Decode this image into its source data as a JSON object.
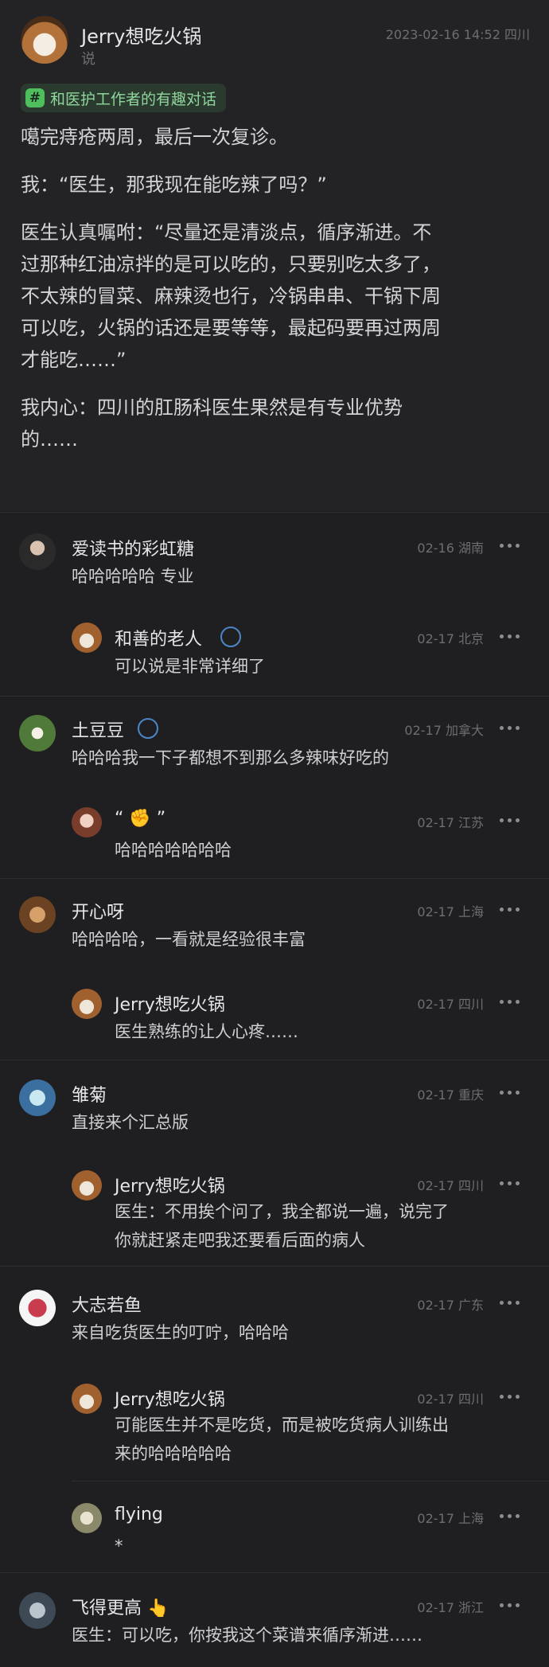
{
  "post": {
    "author": "Jerry想吃火锅",
    "action": "说",
    "time": "2023-02-16 14:52 四川",
    "tag": "和医护工作者的有趣对话",
    "lines": [
      "噶完痔疮两周，最后一次复诊。",
      "",
      "我：“医生，那我现在能吃辣了吗？”",
      "",
      "医生认真嘱咐：“尽量还是清淡点，循序渐进。不",
      "过那种红油凉拌的是可以吃的，只要别吃太多了，",
      "不太辣的冒菜、麻辣烫也行，冷锅串串、干锅下周",
      "可以吃，火锅的话还是要等等，最起码要再过两周",
      "才能吃……”",
      "",
      "我内心：四川的肛肠科医生果然是有专业优势",
      "的……"
    ]
  },
  "comments": [
    {
      "name": "爱读书的彩虹糖",
      "meta": "02-16 湖南",
      "lines": [
        "哈哈哈哈哈 专业"
      ]
    },
    {
      "name": "和善的老人",
      "meta": "02-17 北京",
      "lines": [
        "可以说是非常详细了"
      ]
    },
    {
      "name": "土豆豆",
      "meta": "02-17 加拿大",
      "lines": [
        "哈哈哈我一下子都想不到那么多辣味好吃的"
      ]
    },
    {
      "name": "“ ✊ ”",
      "meta": "02-17 江苏",
      "lines": [
        "哈哈哈哈哈哈哈"
      ]
    },
    {
      "name": "开心呀",
      "meta": "02-17 上海",
      "lines": [
        "哈哈哈哈，一看就是经验很丰富"
      ]
    },
    {
      "name": "Jerry想吃火锅",
      "meta": "02-17 四川",
      "lines": [
        "医生熟练的让人心疼……"
      ]
    },
    {
      "name": "雏菊",
      "meta": "02-17 重庆",
      "lines": [
        "直接来个汇总版"
      ]
    },
    {
      "name": "Jerry想吃火锅",
      "meta": "02-17 四川",
      "lines": [
        "医生：不用挨个问了，我全都说一遍，说完了",
        "你就赶紧走吧我还要看后面的病人"
      ]
    },
    {
      "name": "大志若鱼",
      "meta": "02-17 广东",
      "lines": [
        "来自吃货医生的叮咛，哈哈哈"
      ]
    },
    {
      "name": "Jerry想吃火锅",
      "meta": "02-17 四川",
      "lines": [
        "可能医生并不是吃货，而是被吃货病人训练出",
        "来的哈哈哈哈哈"
      ]
    },
    {
      "name": "flying",
      "meta": "02-17 上海",
      "lines": [
        "*"
      ]
    },
    {
      "name": "飞得更高 👆",
      "meta": "02-17 浙江",
      "lines": [
        "医生：可以吃，你按我这个菜谱来循序渐进……"
      ]
    }
  ],
  "colors": {
    "bg": "#1f1f21",
    "tag_green": "#4fbf5e",
    "text": "#cfcfd2",
    "meta": "#6e6e72"
  }
}
